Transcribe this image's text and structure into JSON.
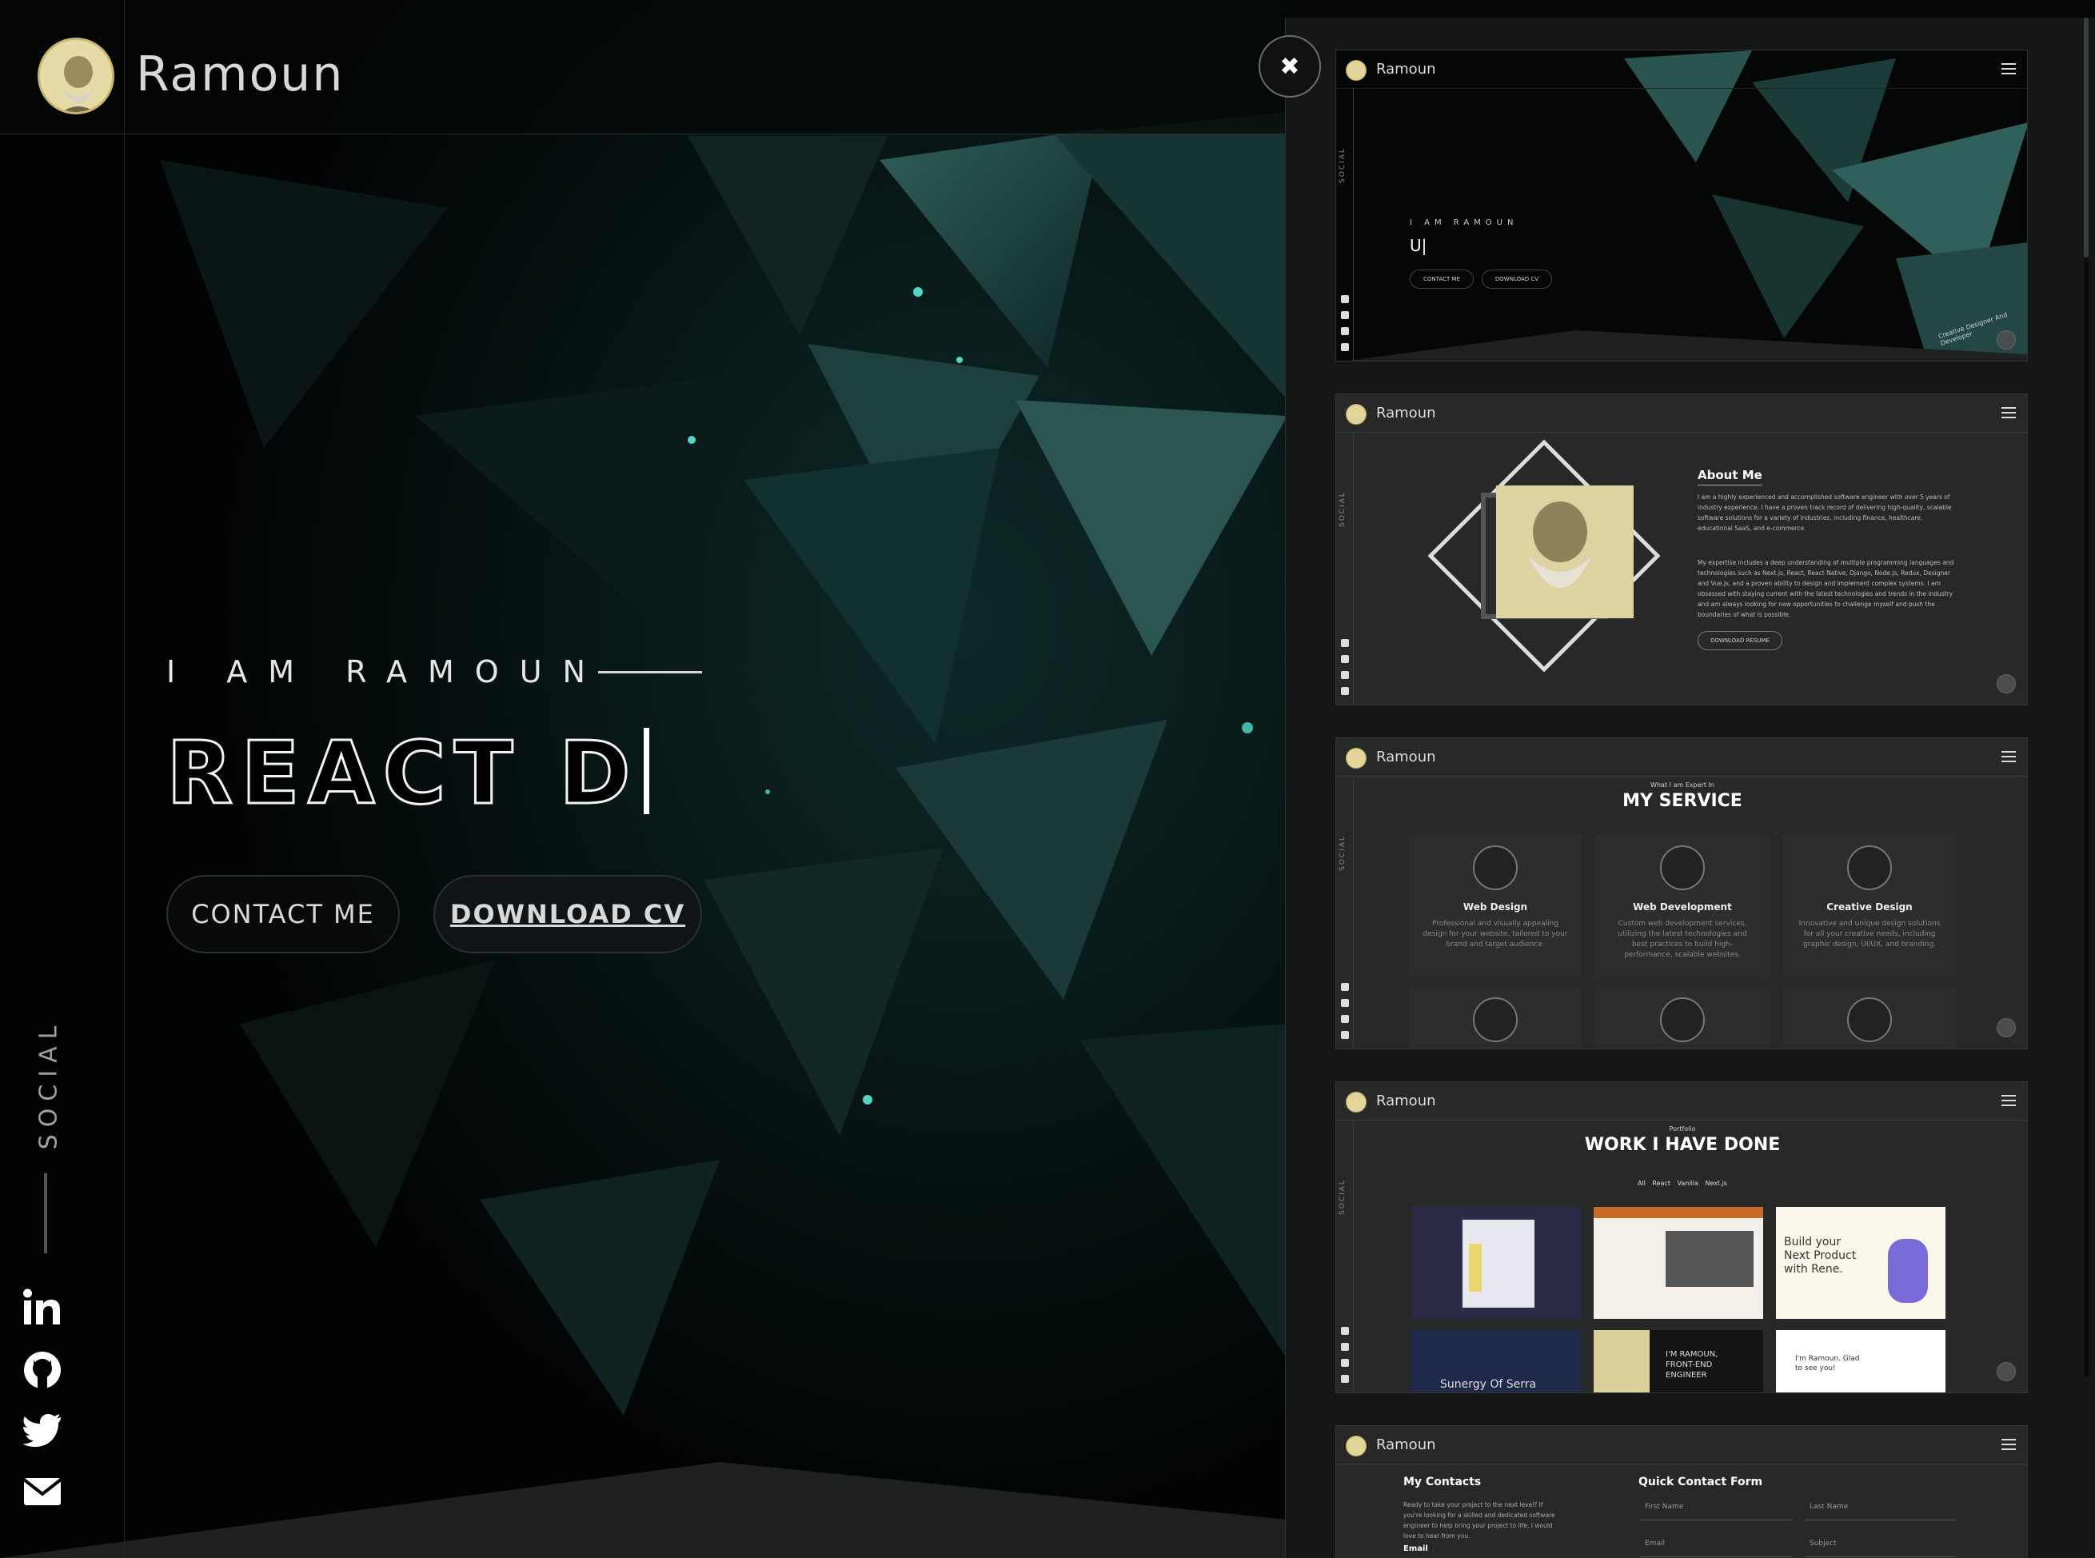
{
  "brand": {
    "name": "Ramoun"
  },
  "hero": {
    "intro": "I AM RAMOUN",
    "role": "REACT D"
  },
  "buttons": {
    "contact": "CONTACT ME",
    "download": "DOWNLOAD CV"
  },
  "social": {
    "label": "SOCIAL",
    "icons": [
      "linkedin-icon",
      "github-icon",
      "twitter-icon",
      "mail-icon"
    ]
  },
  "close": {
    "symbol": "✖"
  },
  "preview_home": {
    "intro": "I AM RAMOUN",
    "role": "U|",
    "contact": "CONTACT ME",
    "download": "DOWNLOAD CV",
    "tagline": "Creative Designer And Developer"
  },
  "preview_about": {
    "title": "About Me",
    "p1": "I am a highly experienced and accomplished software engineer with over 5 years of industry experience. I have a proven track record of delivering high-quality, scalable software solutions for a variety of industries, including finance, healthcare, educational SaaS, and e-commerce.",
    "p2": "My expertise includes a deep understanding of multiple programming languages and technologies such as Next.js, React, React Native, Django, Node.js, Redux, Designer and Vue.js, and a proven ability to design and implement complex systems. I am obsessed with staying current with the latest technologies and trends in the industry and am always looking for new opportunities to challenge myself and push the boundaries of what is possible.",
    "button": "DOWNLOAD RESUME"
  },
  "preview_service": {
    "kicker": "What I am Expert In",
    "title": "MY SERVICE",
    "items": [
      {
        "title": "Web Design",
        "desc": "Professional and visually appealing design for your website, tailored to your brand and target audience."
      },
      {
        "title": "Web Development",
        "desc": "Custom web development services, utilizing the latest technologies and best practices to build high-performance, scalable websites."
      },
      {
        "title": "Creative Design",
        "desc": "Innovative and unique design solutions for all your creative needs, including graphic design, UI/UX, and branding."
      }
    ]
  },
  "preview_portfolio": {
    "kicker": "Portfolio",
    "title": "WORK I HAVE DONE",
    "filters": [
      "All",
      "React",
      "Vanilla",
      "Next.js"
    ],
    "thumb_texts": [
      "Build your Next Product with Rene.",
      "I'M RAMOUN, FRONT-END ENGINEER",
      "Sunergy Of Serra",
      "I'm Ramoun. Glad to see you!"
    ]
  },
  "preview_contact": {
    "title_left": "My Contacts",
    "text": "Ready to take your project to the next level? If you're looking for a skilled and dedicated software engineer to help bring your project to life, I would love to hear from you.",
    "email_label": "Email",
    "title_right": "Quick Contact Form",
    "fields": [
      "First Name",
      "Last Name",
      "Email",
      "Subject"
    ]
  }
}
